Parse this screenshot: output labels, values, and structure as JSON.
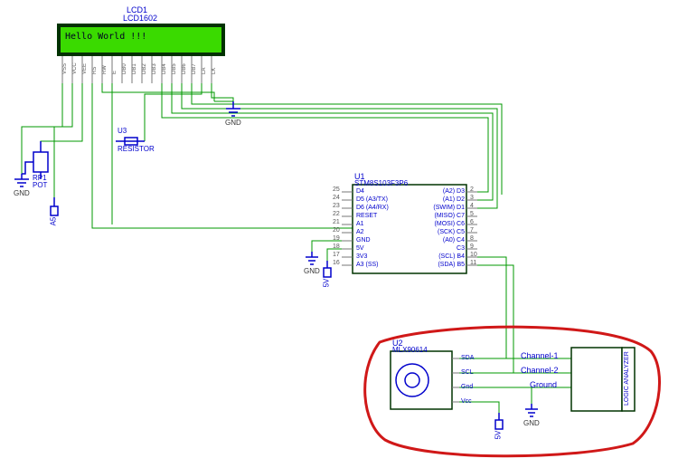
{
  "lcd": {
    "ref": "LCD1",
    "part": "LCD1602",
    "display_text": "Hello World !!!",
    "pins": [
      "VSS",
      "VCC",
      "VEE",
      "RS",
      "RW",
      "E",
      "DB0",
      "DB1",
      "DB2",
      "DB3",
      "DB4",
      "DB5",
      "DB6",
      "DB7",
      "LA",
      "LK"
    ]
  },
  "pot": {
    "ref": "RP1",
    "part": "POT"
  },
  "resistor": {
    "ref": "U3",
    "part": "RESISTOR"
  },
  "mcu": {
    "ref": "U1",
    "part": "STM8S103F3P6",
    "left_pins": [
      {
        "num": "25",
        "name": "D4"
      },
      {
        "num": "24",
        "name": "D5 (A3/TX)"
      },
      {
        "num": "23",
        "name": "D6 (A4/RX)"
      },
      {
        "num": "22",
        "name": "RESET"
      },
      {
        "num": "21",
        "name": "A1"
      },
      {
        "num": "20",
        "name": "A2"
      },
      {
        "num": "19",
        "name": "GND"
      },
      {
        "num": "18",
        "name": "5V"
      },
      {
        "num": "17",
        "name": "3V3"
      },
      {
        "num": "16",
        "name": "A3 (SS)"
      }
    ],
    "right_pins": [
      {
        "num": "2",
        "name": "(A2) D3"
      },
      {
        "num": "3",
        "name": "(A1) D2"
      },
      {
        "num": "4",
        "name": "(SWIM) D1"
      },
      {
        "num": "5",
        "name": "(MISO) C7"
      },
      {
        "num": "6",
        "name": "(MOSI) C6"
      },
      {
        "num": "7",
        "name": "(SCK) C5"
      },
      {
        "num": "8",
        "name": "(A0) C4"
      },
      {
        "num": "9",
        "name": "C3"
      },
      {
        "num": "10",
        "name": "(SCL) B4"
      },
      {
        "num": "11",
        "name": "(SDA) B5"
      }
    ]
  },
  "sensor": {
    "ref": "U2",
    "part": "MLX90614",
    "pins": [
      "SDA",
      "SCL",
      "Gnd",
      "Vcc"
    ]
  },
  "analyzer": {
    "label": "LOGIC ANALYZER",
    "ch1": "Channel-1",
    "ch2": "Channel-2",
    "gnd": "Ground"
  },
  "sym": {
    "gnd": "GND",
    "a5": "A5",
    "v5": "5V"
  }
}
